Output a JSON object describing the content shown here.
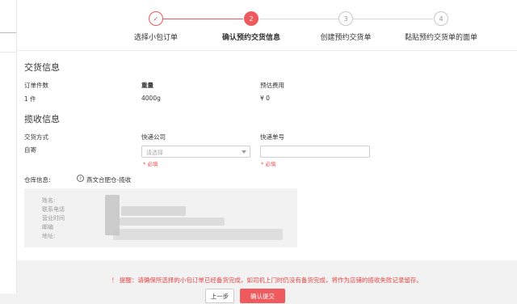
{
  "steps": [
    {
      "number": "✓",
      "label": "选择小包订单"
    },
    {
      "number": "2",
      "label": "确认预约交货信息"
    },
    {
      "number": "3",
      "label": "创建预约交货单"
    },
    {
      "number": "4",
      "label": "黏贴预约交货单的面单"
    }
  ],
  "delivery": {
    "title": "交货信息",
    "order_count_label": "订单件数",
    "order_count_value": "1 件",
    "weight_label": "重量",
    "weight_value": "4000g",
    "fee_label": "预估费用",
    "fee_value": "¥ 0"
  },
  "pickup": {
    "title": "揽收信息",
    "method_label": "交货方式",
    "method_value": "自寄",
    "courier_label": "快递公司",
    "courier_placeholder": "请选择",
    "courier_required": "* 必填",
    "tracking_label": "快递单号",
    "tracking_value": "",
    "tracking_required": "* 必填"
  },
  "warehouse": {
    "label": "仓库信息:",
    "help_icon": "?",
    "name": "燕文合肥仓-揽收",
    "fields": [
      "姓名:",
      "联系电话",
      "营业时间",
      "邮编",
      "地址:"
    ]
  },
  "footer": {
    "tip": "！ 提醒：请确保所选择的小包订单已经备货完成，如司机上门时仍没有备货完成，将作为店铺的揽收失败记录留存。",
    "prev_label": "上一步",
    "submit_label": "确认提交"
  },
  "colors": {
    "accent": "#ef5a5f",
    "required": "#ef4b4b"
  }
}
